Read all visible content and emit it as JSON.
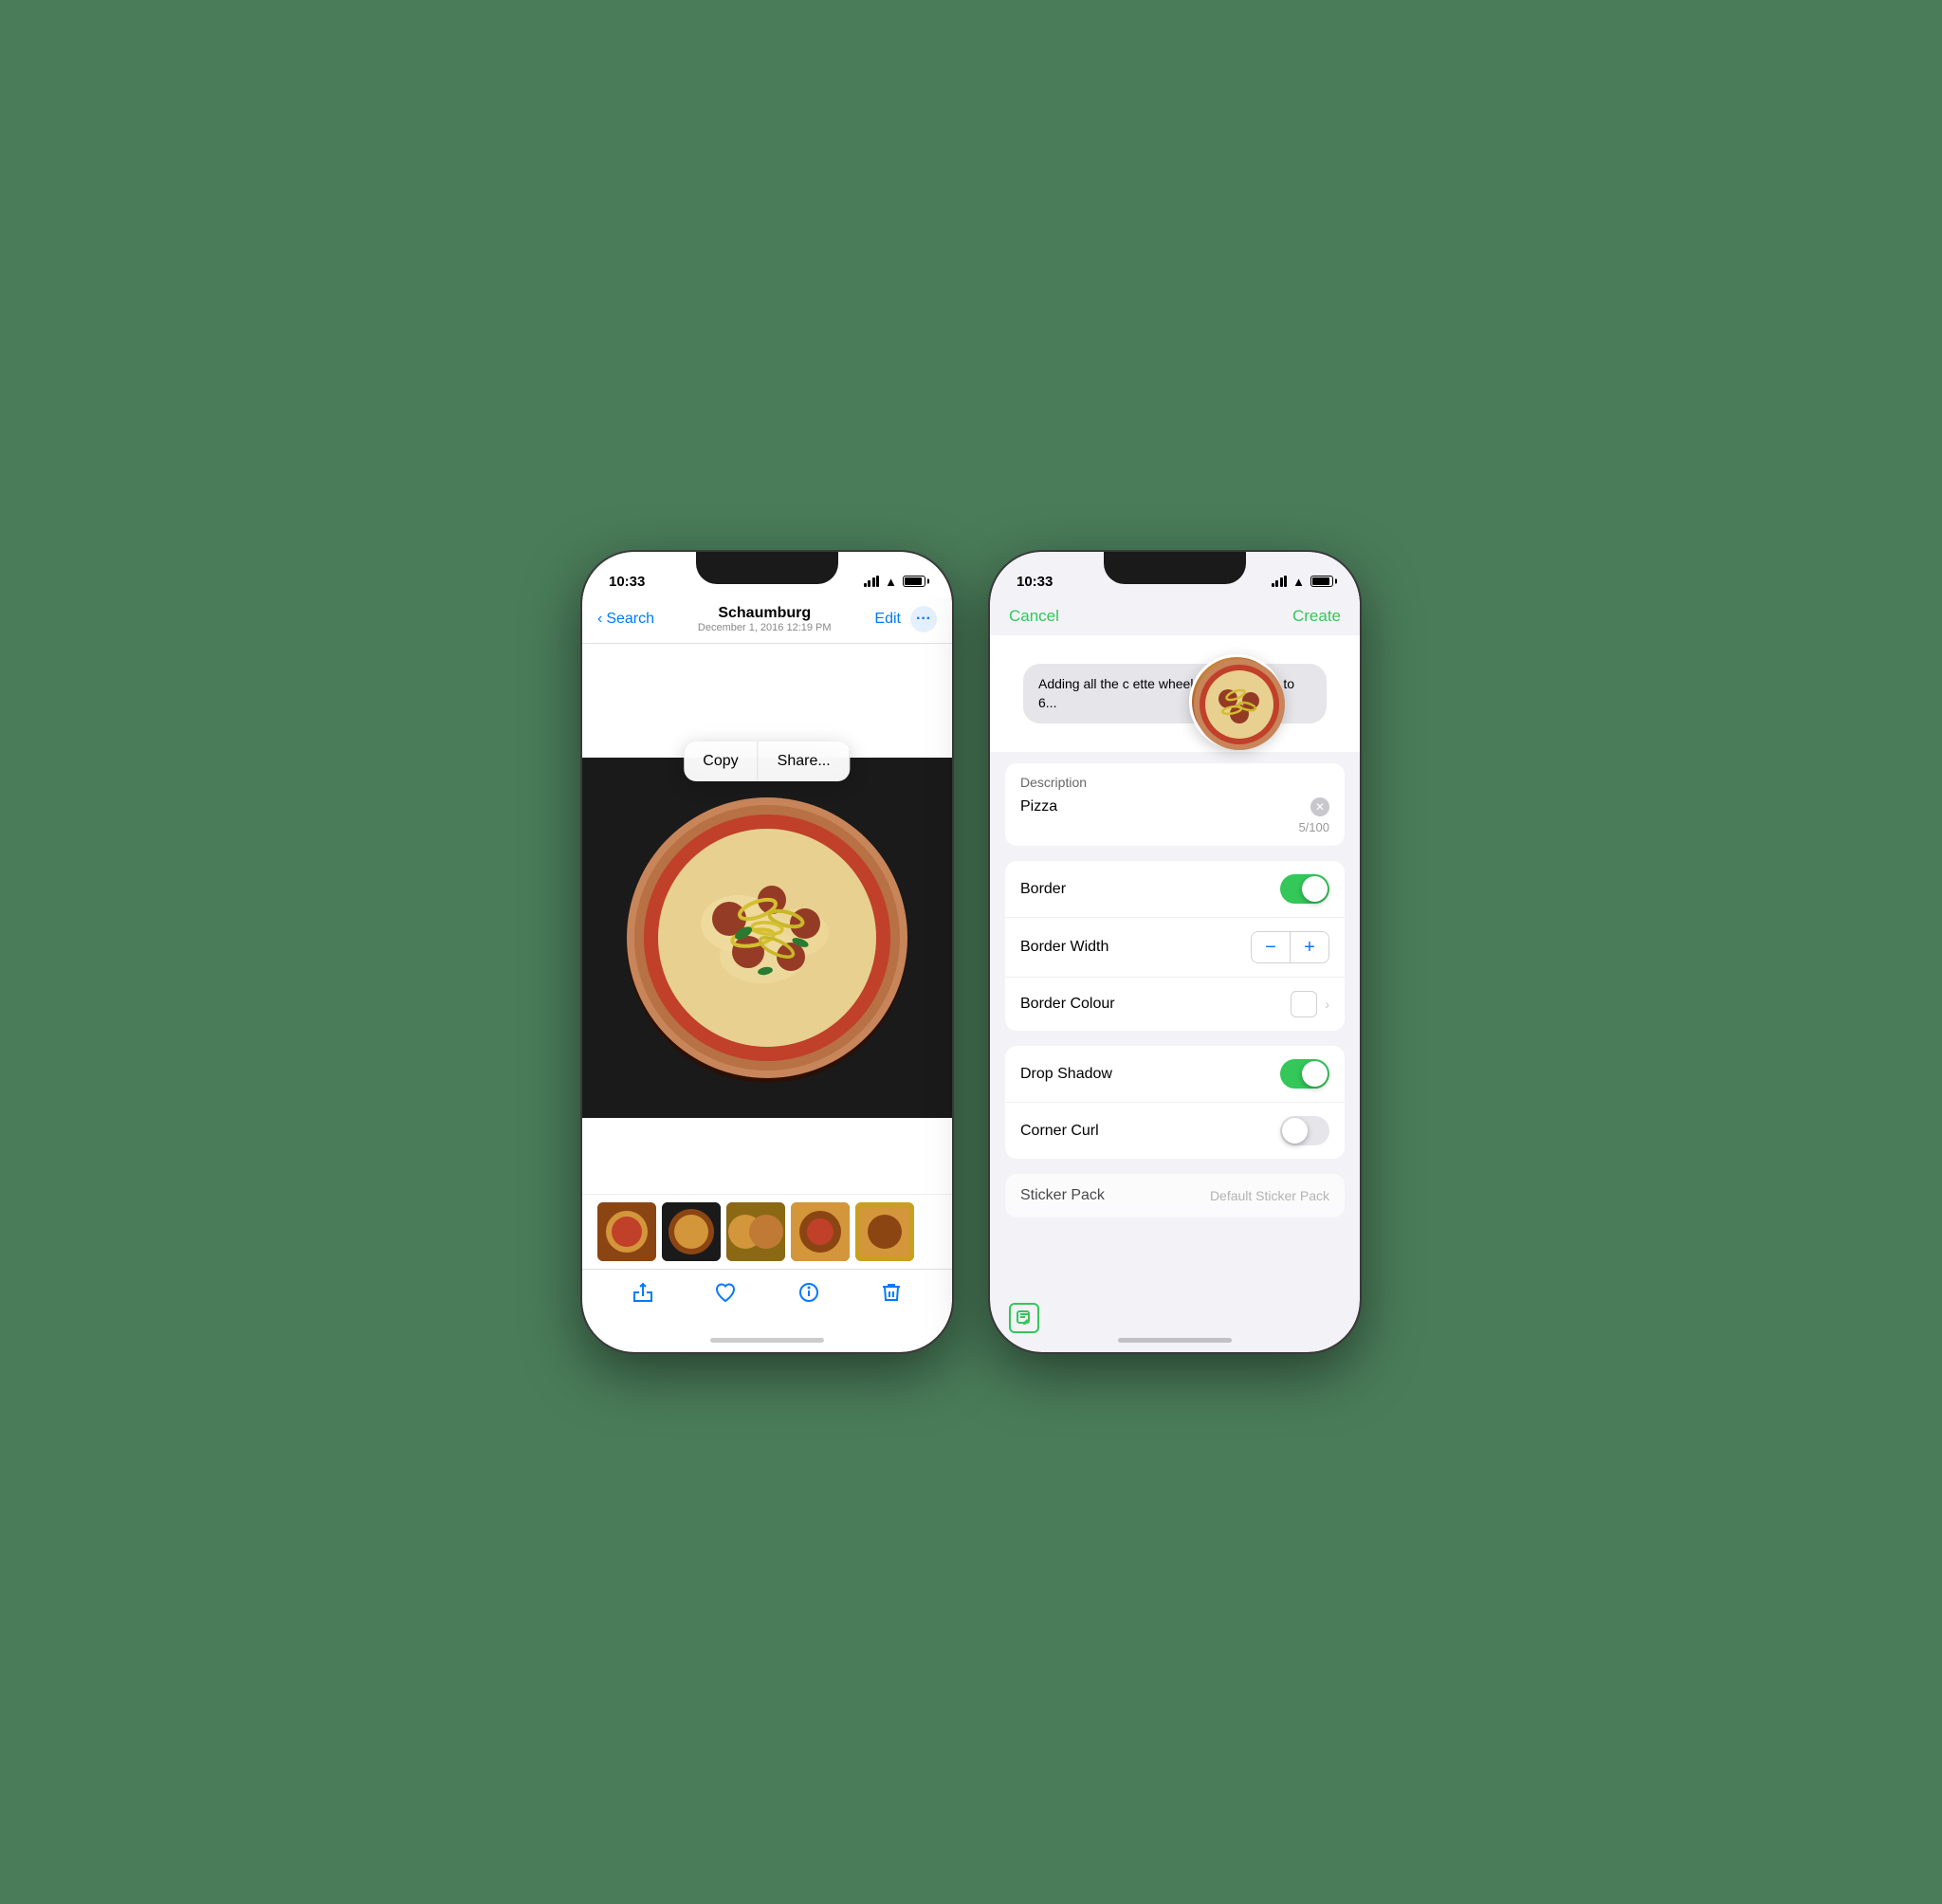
{
  "page": {
    "background": "#4a7c59"
  },
  "phone1": {
    "status": {
      "time": "10:33",
      "status_icon": "🏔",
      "signal": [
        4,
        7,
        10,
        12
      ],
      "wifi": true,
      "battery": true
    },
    "nav": {
      "back_label": "Search",
      "title": "Schaumburg",
      "subtitle": "December 1, 2016  12:19 PM",
      "edit_label": "Edit",
      "more_icon": "···"
    },
    "context_menu": {
      "copy_label": "Copy",
      "share_label": "Share..."
    },
    "toolbar": {
      "share_icon": "share",
      "heart_icon": "heart",
      "info_icon": "info",
      "trash_icon": "trash"
    }
  },
  "phone2": {
    "status": {
      "time": "10:33",
      "status_icon": "🏔"
    },
    "nav": {
      "cancel_label": "Cancel",
      "create_label": "Create"
    },
    "message": {
      "text": "Adding all the c        ette wheel will equivalent to 6..."
    },
    "description": {
      "label": "Description",
      "value": "Pizza",
      "char_count": "5/100",
      "placeholder": "Pizza"
    },
    "border_section": {
      "border_label": "Border",
      "border_enabled": true,
      "border_width_label": "Border Width",
      "border_colour_label": "Border Colour"
    },
    "effects_section": {
      "drop_shadow_label": "Drop Shadow",
      "drop_shadow_enabled": true,
      "corner_curl_label": "Corner Curl",
      "corner_curl_enabled": false
    },
    "sticker_pack": {
      "label": "Sticker Pack",
      "value": "Default Sticker Pack"
    }
  }
}
